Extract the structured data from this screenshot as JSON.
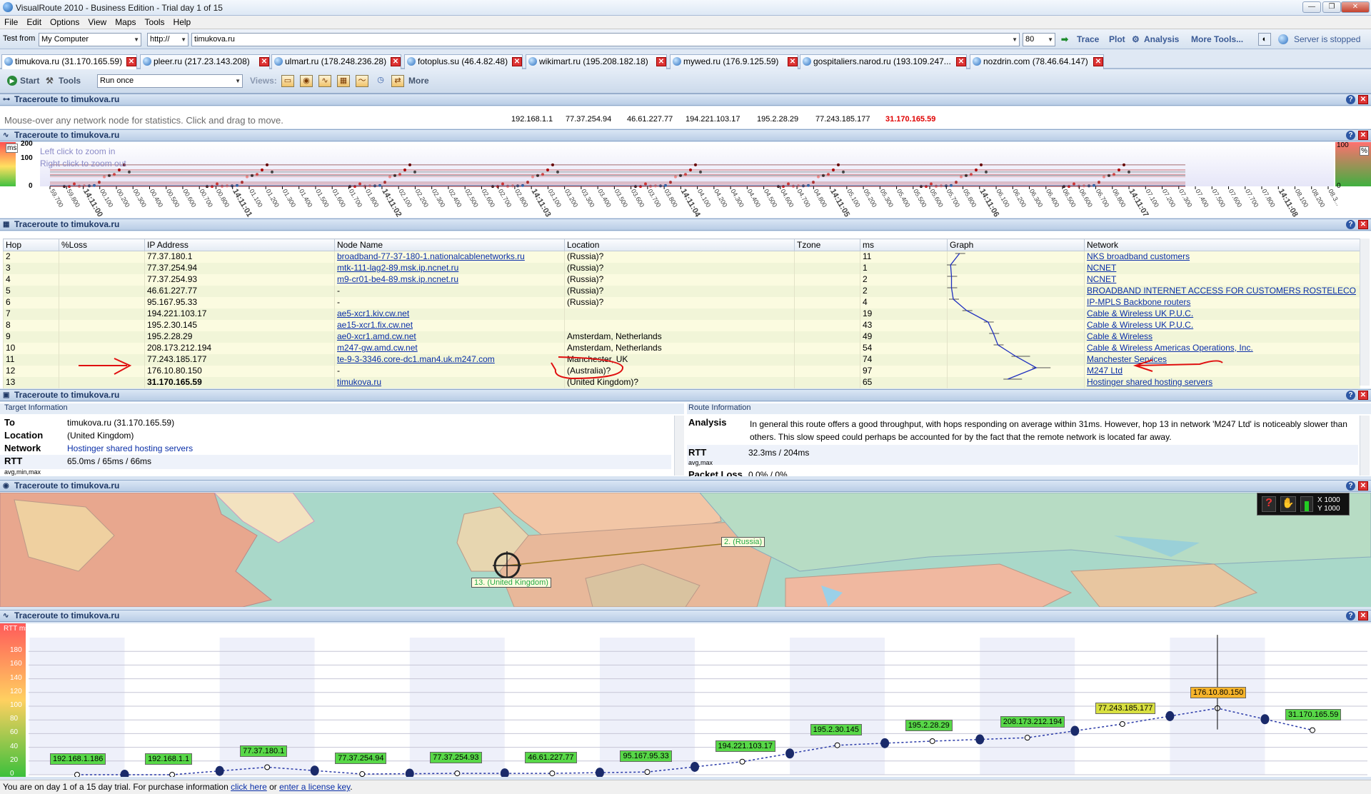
{
  "window": {
    "title": "VisualRoute 2010 - Business Edition - Trial day 1 of 15",
    "btn_min": "—",
    "btn_max": "❐",
    "btn_close": "✕"
  },
  "menu": [
    "File",
    "Edit",
    "Options",
    "View",
    "Maps",
    "Tools",
    "Help"
  ],
  "urlbar": {
    "test_from_label": "Test from",
    "test_from_value": "My Computer",
    "protocol": "http://",
    "url": "timukova.ru",
    "port": "80",
    "trace": "Trace",
    "plot": "Plot",
    "analysis": "Analysis",
    "more_tools": "More Tools...",
    "server_status": "Server is stopped"
  },
  "tabs": [
    {
      "label": "timukova.ru (31.170.165.59)"
    },
    {
      "label": "pleer.ru (217.23.143.208)"
    },
    {
      "label": "ulmart.ru (178.248.236.28)"
    },
    {
      "label": "fotoplus.su (46.4.82.48)"
    },
    {
      "label": "wikimart.ru (195.208.182.18)"
    },
    {
      "label": "mywed.ru (176.9.125.59)"
    },
    {
      "label": "gospitaliers.narod.ru (193.109.247..."
    },
    {
      "label": "nozdrin.com (78.46.64.147)"
    }
  ],
  "toolbar2": {
    "start": "Start",
    "tools": "Tools",
    "run_mode": "Run once",
    "views": "Views:",
    "more": "More"
  },
  "panels": {
    "net": {
      "title": "Traceroute to timukova.ru",
      "hint": "Mouse-over any network node for statistics. Click and drag to move.",
      "nodes": [
        "192.168.1.1",
        "77.37.254.94",
        "46.61.227.77",
        "194.221.103.17",
        "195.2.28.29",
        "77.243.185.177",
        "31.170.165.59"
      ],
      "highlight_color": "#e00000"
    },
    "timeline": {
      "title": "Traceroute to timukova.ru",
      "hint1": "Left click to zoom in",
      "hint2": "Right click to zoom out",
      "yunit": "ms",
      "y200": "200",
      "y100": "100",
      "y0": "0",
      "runit": "%",
      "r100": "100",
      "r0": "0",
      "ticks": [
        "59.700",
        "59.800",
        "14:11:00",
        "00.100",
        "00.200",
        "00.300",
        "00.400",
        "00.500",
        "00.600",
        "00.700",
        "00.800",
        "14:11:01",
        "01.100",
        "01.200",
        "01.300",
        "01.400",
        "01.500",
        "01.600",
        "01.700",
        "01.800",
        "14:11:02",
        "02.100",
        "02.200",
        "02.300",
        "02.400",
        "02.500",
        "02.600",
        "02.700",
        "02.800",
        "14:11:03",
        "03.100",
        "03.200",
        "03.300",
        "03.400",
        "03.500",
        "03.600",
        "03.700",
        "03.800",
        "14:11:04",
        "04.100",
        "04.200",
        "04.300",
        "04.400",
        "04.500",
        "04.600",
        "04.700",
        "04.800",
        "14:11:05",
        "05.100",
        "05.200",
        "05.300",
        "05.400",
        "05.500",
        "05.600",
        "05.700",
        "05.800",
        "14:11:06",
        "06.100",
        "06.200",
        "06.300",
        "06.400",
        "06.500",
        "06.600",
        "06.700",
        "06.800",
        "14:11:07",
        "07.100",
        "07.200",
        "07.300",
        "07.400",
        "07.500",
        "07.600",
        "07.700",
        "07.800",
        "14:11:08",
        "08.100",
        "08.200",
        "08.3..."
      ]
    },
    "table": {
      "title": "Traceroute to timukova.ru",
      "headers": [
        "Hop",
        "%Loss",
        "IP Address",
        "Node Name",
        "Location",
        "Tzone",
        "ms",
        "Graph",
        "Network"
      ],
      "rows": [
        {
          "hop": "2",
          "loss": "",
          "ip": "77.37.180.1",
          "node": "broadband-77-37-180-1.nationalcablenetworks.ru",
          "loc": "(Russia)?",
          "tz": "",
          "ms": "11",
          "net": "NKS broadband customers"
        },
        {
          "hop": "3",
          "loss": "",
          "ip": "77.37.254.94",
          "node": "mtk-111-lag2-89.msk.ip.ncnet.ru",
          "loc": "(Russia)?",
          "tz": "",
          "ms": "1",
          "net": "NCNET"
        },
        {
          "hop": "4",
          "loss": "",
          "ip": "77.37.254.93",
          "node": "m9-cr01-be4-89.msk.ip.ncnet.ru",
          "loc": "(Russia)?",
          "tz": "",
          "ms": "2",
          "net": "NCNET"
        },
        {
          "hop": "5",
          "loss": "",
          "ip": "46.61.227.77",
          "node": "-",
          "loc": "(Russia)?",
          "tz": "",
          "ms": "2",
          "net": "BROADBAND INTERNET ACCESS FOR CUSTOMERS ROSTELECO"
        },
        {
          "hop": "6",
          "loss": "",
          "ip": "95.167.95.33",
          "node": "-",
          "loc": "(Russia)?",
          "tz": "",
          "ms": "4",
          "net": "IP-MPLS Backbone routers"
        },
        {
          "hop": "7",
          "loss": "",
          "ip": "194.221.103.17",
          "node": "ae5-xcr1.kiv.cw.net",
          "loc": "",
          "tz": "",
          "ms": "19",
          "net": "Cable & Wireless UK P.U.C."
        },
        {
          "hop": "8",
          "loss": "",
          "ip": "195.2.30.145",
          "node": "ae15-xcr1.fix.cw.net",
          "loc": "",
          "tz": "",
          "ms": "43",
          "net": "Cable & Wireless UK P.U.C."
        },
        {
          "hop": "9",
          "loss": "",
          "ip": "195.2.28.29",
          "node": "ae0-xcr1.amd.cw.net",
          "loc": "Amsterdam, Netherlands",
          "tz": "",
          "ms": "49",
          "net": "Cable & Wireless"
        },
        {
          "hop": "10",
          "loss": "",
          "ip": "208.173.212.194",
          "node": "m247-gw.amd.cw.net",
          "loc": "Amsterdam, Netherlands",
          "tz": "",
          "ms": "54",
          "net": "Cable & Wireless Americas Operations, Inc."
        },
        {
          "hop": "11",
          "loss": "",
          "ip": "77.243.185.177",
          "node": "te-9-3-3346.core-dc1.man4.uk.m247.com",
          "loc": "Manchester, UK",
          "tz": "",
          "ms": "74",
          "net": "Manchester Services"
        },
        {
          "hop": "12",
          "loss": "",
          "ip": "176.10.80.150",
          "node": "-",
          "loc": "(Australia)?",
          "tz": "",
          "ms": "97",
          "net": "M247 Ltd"
        },
        {
          "hop": "13",
          "loss": "",
          "ip": "31.170.165.59",
          "node": "timukova.ru",
          "loc": "(United Kingdom)?",
          "tz": "",
          "ms": "65",
          "net": "Hostinger shared hosting servers"
        }
      ],
      "annotation_color": "#e01010"
    },
    "info": {
      "title": "Traceroute to timukova.ru",
      "target_header": "Target Information",
      "route_header": "Route Information",
      "to_label": "To",
      "to_value": "timukova.ru (31.170.165.59)",
      "location_label": "Location",
      "location_value": "(United Kingdom)",
      "network_label": "Network",
      "network_value": "Hostinger shared hosting servers",
      "rtt_label": "RTT",
      "rtt_value": "65.0ms / 65ms / 66ms",
      "rtt_sub": "avg,min,max",
      "analysis_label": "Analysis",
      "analysis_text": "In general this route offers a good throughput, with hops responding on average within 31ms. However, hop 13 in network 'M247 Ltd' is noticeably slower than others. This slow speed could perhaps be accounted for by the fact that the remote network is located far away.",
      "route_rtt_label": "RTT",
      "route_rtt_value": "32.3ms / 204ms",
      "route_rtt_sub": "avg,max",
      "packet_loss_label": "Packet Loss",
      "packet_loss_value": "0.0% / 0%"
    },
    "map": {
      "title": "Traceroute to timukova.ru",
      "label_russia": "2. (Russia)",
      "label_uk": "13. (United Kingdom)",
      "coord_x": "X 1000",
      "coord_y": "Y 1000"
    },
    "rtt": {
      "title": "Traceroute to timukova.ru",
      "yunit": "RTT ms",
      "yticks": [
        "180",
        "160",
        "140",
        "120",
        "100",
        "80",
        "60",
        "40",
        "20",
        "0"
      ],
      "labels": [
        "192.168.1.186",
        "192.168.1.1",
        "77.37.180.1",
        "77.37.254.94",
        "77.37.254.93",
        "46.61.227.77",
        "95.167.95.33",
        "194.221.103.17",
        "195.2.30.145",
        "195.2.28.29",
        "208.173.212.194",
        "77.243.185.177",
        "176.10.80.150",
        "31.170.165.59"
      ]
    }
  },
  "chart_data": {
    "type": "line",
    "title": "Traceroute to timukova.ru",
    "ylabel": "RTT ms",
    "ylim": [
      0,
      200
    ],
    "categories": [
      "192.168.1.186",
      "192.168.1.1",
      "77.37.180.1",
      "77.37.254.94",
      "77.37.254.93",
      "46.61.227.77",
      "95.167.95.33",
      "194.221.103.17",
      "195.2.30.145",
      "195.2.28.29",
      "208.173.212.194",
      "77.243.185.177",
      "176.10.80.150",
      "31.170.165.59"
    ],
    "values": [
      0,
      0,
      11,
      1,
      2,
      2,
      4,
      19,
      43,
      49,
      54,
      74,
      97,
      65
    ],
    "grid": true
  },
  "statusbar": {
    "text1": "You are on day 1 of a 15 day trial. For purchase information ",
    "link1": "click here",
    "text2": " or ",
    "link2": "enter a license key",
    "text3": "."
  }
}
